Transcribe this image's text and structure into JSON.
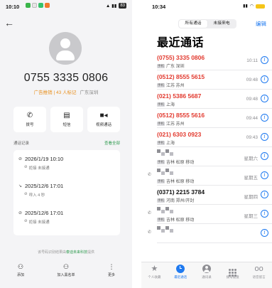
{
  "left": {
    "status": {
      "time": "10:10",
      "right_text": "83"
    },
    "phone": "0755 3335 0806",
    "tag": "广告推销 | 43 人标记",
    "location": "广东深圳",
    "actions": [
      {
        "label": "拨号",
        "icon": "phone-icon"
      },
      {
        "label": "短信",
        "icon": "message-icon"
      },
      {
        "label": "视频通话",
        "icon": "video-icon"
      }
    ],
    "records_title": "通话记录",
    "records_all": "查看全部",
    "records": [
      {
        "date": "2026/1/19 10:10",
        "detail": "拒接 未接通",
        "icon": "blocked-icon"
      },
      {
        "date": "2025/12/6 17:01",
        "detail": "呼入 4 秒",
        "icon": "incoming-icon"
      },
      {
        "date": "2025/12/6 17:01",
        "detail": "拒接 未接通",
        "icon": "blocked-icon"
      }
    ],
    "provider_prefix": "该号码识别结果由",
    "provider_link": "泰迪未来科技",
    "provider_suffix": "提供",
    "bottom": [
      {
        "label": "添加",
        "icon": "add-contact-icon"
      },
      {
        "label": "加入黑名单",
        "icon": "block-user-icon"
      },
      {
        "label": "更多",
        "icon": "more-icon"
      }
    ]
  },
  "right": {
    "status": {
      "time": "10:34"
    },
    "segments": [
      "所有通话",
      "未接来电"
    ],
    "edit": "编辑",
    "title": "最近通话",
    "calls": [
      {
        "number": "(0755) 3335 0806",
        "location": "广东 深圳",
        "time": "10:11",
        "missed": true,
        "blurred": false,
        "outgoing": false
      },
      {
        "number": "(0512) 8555 5615",
        "location": "江苏 苏州",
        "time": "09:48",
        "missed": true,
        "blurred": false,
        "outgoing": false
      },
      {
        "number": "(021) 5386 5687",
        "location": "上海",
        "time": "09:48",
        "missed": true,
        "blurred": false,
        "outgoing": false
      },
      {
        "number": "(0512) 8555 5616",
        "location": "江苏 苏州",
        "time": "09:44",
        "missed": true,
        "blurred": false,
        "outgoing": false
      },
      {
        "number": "(021) 6303 0923",
        "location": "上海",
        "time": "09:43",
        "missed": true,
        "blurred": false,
        "outgoing": false
      },
      {
        "number": "",
        "location": "吉林 松原 移动",
        "time": "星期六",
        "missed": false,
        "blurred": true,
        "outgoing": false
      },
      {
        "number": "",
        "location": "吉林 松原 移动",
        "time": "星期五",
        "missed": false,
        "blurred": true,
        "outgoing": true
      },
      {
        "number": "(0371) 2215 3784",
        "location": "河南 郑州/开封",
        "time": "星期四",
        "missed": false,
        "blurred": false,
        "outgoing": false
      },
      {
        "number": "",
        "location": "吉林 松原 移动",
        "time": "星期三",
        "missed": false,
        "blurred": true,
        "outgoing": true
      },
      {
        "number": "",
        "location": "",
        "time": "",
        "missed": false,
        "blurred": true,
        "outgoing": true
      }
    ],
    "badge": "手机",
    "tabs": [
      {
        "label": "个人收藏",
        "icon": "star-icon",
        "active": false
      },
      {
        "label": "最近通话",
        "icon": "clock-icon",
        "active": true
      },
      {
        "label": "通讯录",
        "icon": "contacts-icon",
        "active": false
      },
      {
        "label": "拨号键盘",
        "icon": "keypad-icon",
        "active": false
      },
      {
        "label": "语音留言",
        "icon": "voicemail-icon",
        "active": false
      }
    ]
  }
}
